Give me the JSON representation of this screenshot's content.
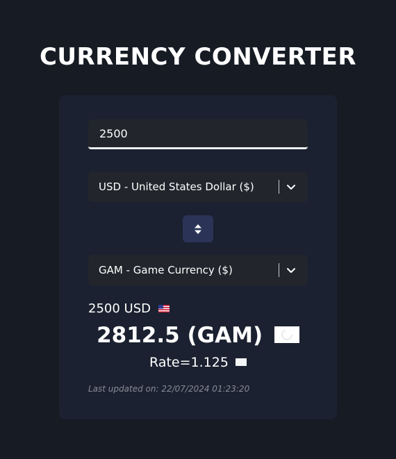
{
  "app": {
    "title": "CURRENCY CONVERTER"
  },
  "converter": {
    "amount_value": "2500",
    "from_currency": "USD - United States Dollar ($)",
    "to_currency": "GAM - Game Currency ($)",
    "from_amount_text": "2500 USD",
    "result_text": "2812.5 (GAM)",
    "rate_text": "Rate=1.125",
    "last_updated": "Last updated on: 22/07/2024 01:23:20"
  },
  "icons": {
    "swap": "swap-vertical-icon",
    "chevron": "chevron-down-icon",
    "from_flag": "us-flag-icon",
    "to_flag": "game-currency-flag-icon",
    "rate_flag": "flag-icon"
  },
  "colors": {
    "background": "#161b24",
    "card": "#1b2130",
    "input": "#22262c",
    "swap_button": "#2b3357",
    "muted_text": "#878c96"
  }
}
